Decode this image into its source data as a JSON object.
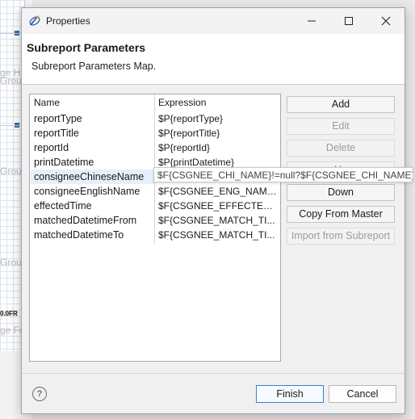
{
  "background": {
    "bands": [
      "ge He",
      "Grou",
      "Grou",
      "Grou",
      "ge Fo"
    ],
    "field_label": "0.0FR"
  },
  "dialog": {
    "title": "Properties",
    "header_title": "Subreport Parameters",
    "header_desc": "Subreport Parameters Map.",
    "table": {
      "columns": [
        "Name",
        "Expression"
      ],
      "rows": [
        {
          "name": "reportType",
          "expr": "$P{reportType}"
        },
        {
          "name": "reportTitle",
          "expr": "$P{reportTitle}"
        },
        {
          "name": "reportId",
          "expr": "$P{reportId}"
        },
        {
          "name": "printDatetime",
          "expr": "$P{printDatetime}"
        },
        {
          "name": "consigneeChineseName",
          "expr": "$F{CSGNEE_CHI_NAME}!=null?$F{CSGNEE_CHI_NAME}:\"-\""
        },
        {
          "name": "consigneeEnglishName",
          "expr": "$F{CSGNEE_ENG_NAME..."
        },
        {
          "name": "effectedTime",
          "expr": "$F{CSGNEE_EFFECTED_..."
        },
        {
          "name": "matchedDatetimeFrom",
          "expr": "$F{CSGNEE_MATCH_TI..."
        },
        {
          "name": "matchedDatetimeTo",
          "expr": "$F{CSGNEE_MATCH_TI..."
        }
      ],
      "selected_index": 4,
      "tooltip": "$F{CSGNEE_CHI_NAME}!=null?$F{CSGNEE_CHI_NAME}:\"-\""
    },
    "buttons": {
      "add": "Add",
      "edit": "Edit",
      "delete": "Delete",
      "up": "Up",
      "down": "Down",
      "copy_from_master": "Copy From Master",
      "import_from_subreport": "Import from Subreport"
    },
    "footer": {
      "finish": "Finish",
      "cancel": "Cancel",
      "help_symbol": "?"
    }
  }
}
